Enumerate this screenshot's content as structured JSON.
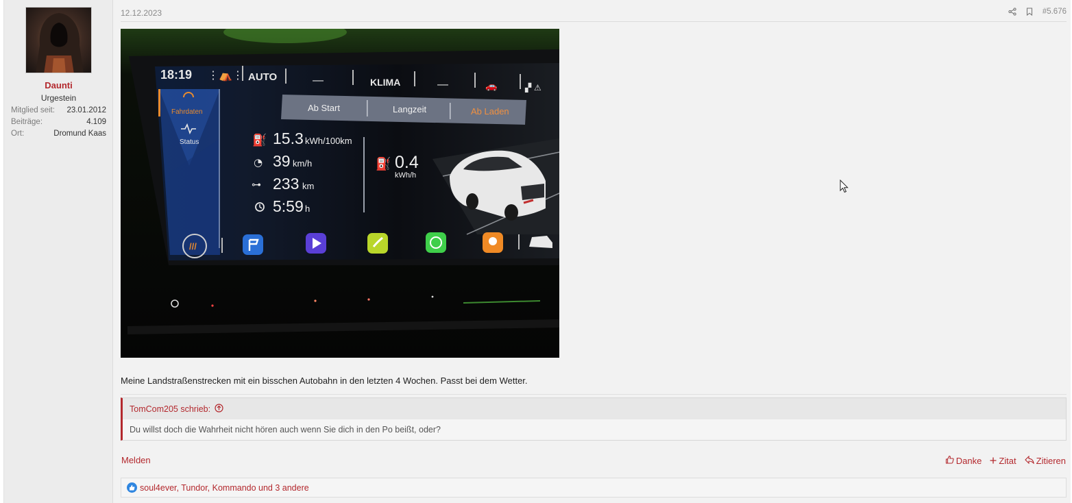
{
  "user": {
    "name": "Daunti",
    "title": "Urgestein",
    "stats": [
      {
        "label": "Mitglied seit:",
        "value": "23.01.2012"
      },
      {
        "label": "Beiträge:",
        "value": "4.109"
      },
      {
        "label": "Ort:",
        "value": "Dromund Kaas"
      }
    ]
  },
  "post": {
    "date": "12.12.2023",
    "number": "#5.676",
    "text": "Meine Landstraßenstrecken mit ein bisschen Autobahn in den letzten 4 Wochen. Passt bei dem Wetter."
  },
  "screen": {
    "time": "18:19",
    "auto": "AUTO",
    "climate": "KLIMA",
    "dash": "—",
    "menu": [
      "Fahrdaten",
      "Status"
    ],
    "tabs": [
      "Ab Start",
      "Langzeit",
      "Ab Laden"
    ],
    "stats": [
      {
        "value": "15.3",
        "unit": "kWh/100km"
      },
      {
        "value": "39",
        "unit": "km/h"
      },
      {
        "value": "233",
        "unit": "km"
      },
      {
        "value": "5:59",
        "unit": "h"
      }
    ],
    "consumption": {
      "value": "0.4",
      "unit": "kWh/h"
    }
  },
  "quote": {
    "author": "TomCom205 schrieb:",
    "text": "Du willst doch die Wahrheit nicht hören auch wenn Sie dich in den Po beißt, oder?"
  },
  "footer": {
    "report": "Melden",
    "thanks": "Danke",
    "zitat": "Zitat",
    "zitieren": "Zitieren"
  },
  "reactions": {
    "text": "soul4ever, Tundor, Kommando und 3 andere"
  },
  "colors": {
    "accent": "#b3282d",
    "like": "#2f86e0"
  }
}
